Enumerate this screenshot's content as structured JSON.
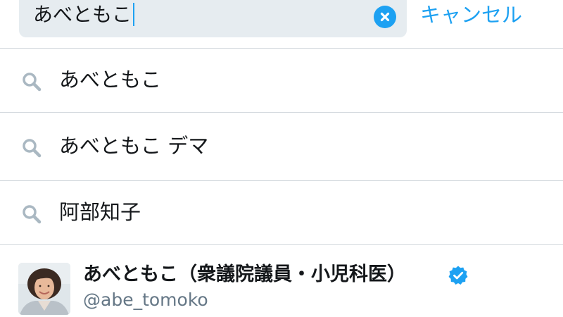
{
  "search": {
    "query": "あべともこ",
    "clear_icon": "clear-x-icon"
  },
  "cancel_label": "キャンセル",
  "suggestions": [
    {
      "text": "あべともこ",
      "icon": "search-icon"
    },
    {
      "text": "あべともこ デマ",
      "icon": "search-icon"
    },
    {
      "text": "阿部知子",
      "icon": "search-icon"
    }
  ],
  "user_result": {
    "name": "あべともこ（衆議院議員・小児科医）",
    "handle": "@abe_tomoko",
    "verified": true
  },
  "colors": {
    "accent": "#1da1f2",
    "search_bg": "#e6ecf0",
    "text": "#14171a",
    "secondary_text": "#657786",
    "divider": "#d2d8dd",
    "icon_gray": "#aab8c2"
  }
}
